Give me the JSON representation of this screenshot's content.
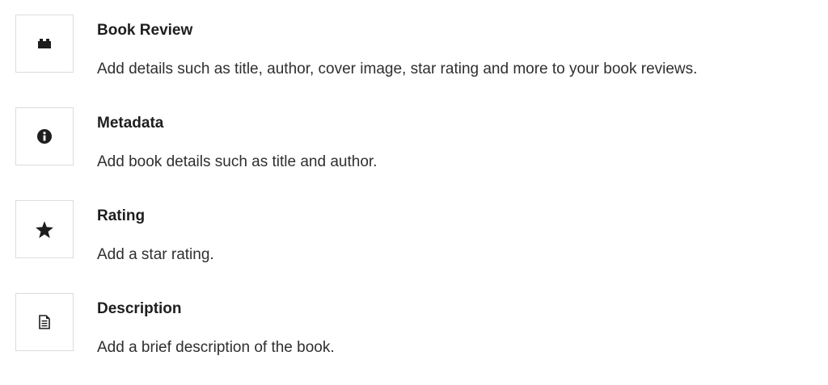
{
  "blocks": [
    {
      "title": "Book Review",
      "description": "Add details such as title, author, cover image, star rating and more to your book reviews.",
      "icon": "block-icon"
    },
    {
      "title": "Metadata",
      "description": "Add book details such as title and author.",
      "icon": "info-icon"
    },
    {
      "title": "Rating",
      "description": "Add a star rating.",
      "icon": "star-icon"
    },
    {
      "title": "Description",
      "description": "Add a brief description of the book.",
      "icon": "document-icon"
    }
  ]
}
